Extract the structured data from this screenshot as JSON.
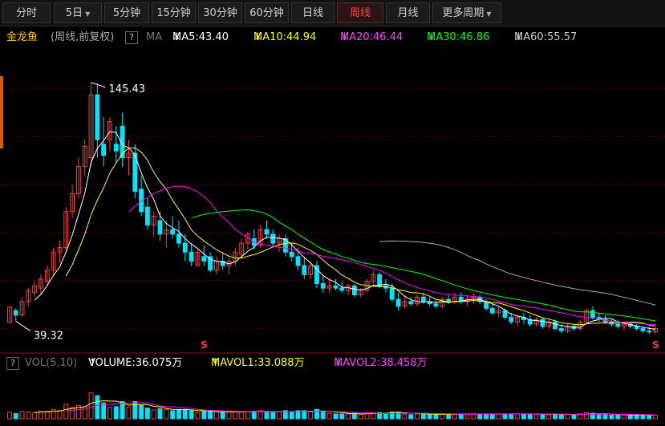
{
  "toolbar": {
    "tabs": [
      {
        "label": "分时",
        "active": false,
        "dropdown": false
      },
      {
        "label": "5日",
        "active": false,
        "dropdown": true
      },
      {
        "label": "5分钟",
        "active": false,
        "dropdown": false
      },
      {
        "label": "15分钟",
        "active": false,
        "dropdown": false
      },
      {
        "label": "30分钟",
        "active": false,
        "dropdown": false
      },
      {
        "label": "60分钟",
        "active": false,
        "dropdown": false
      },
      {
        "label": "日线",
        "active": false,
        "dropdown": false
      },
      {
        "label": "周线",
        "active": true,
        "dropdown": false
      },
      {
        "label": "月线",
        "active": false,
        "dropdown": false
      },
      {
        "label": "更多周期",
        "active": false,
        "dropdown": true
      }
    ]
  },
  "header": {
    "stock_name": "金龙鱼",
    "mode": "(周线,前复权)",
    "help": "?",
    "ma_label": "MA",
    "ma5": "MA5:43.40",
    "ma10": "MA10:44.94",
    "ma20": "MA20:46.44",
    "ma30": "MA30:46.86",
    "ma60": "MA60:55.57",
    "arrow_down": "↓"
  },
  "volume_header": {
    "label": "VOL(5,10)",
    "volume": "VOLUME:36.075万",
    "mavol1": "MAVOL1:33.088万",
    "mavol2": "MAVOL2:38.458万",
    "arrow_up": "↑",
    "arrow_down": "↓",
    "help": "?"
  },
  "colors": {
    "up": "#ff3c3c",
    "down": "#00e5ff",
    "ma5": "#ffffff",
    "ma10": "#ffff00",
    "ma20": "#ff00ff",
    "ma30": "#00ff00",
    "ma60": "#aaaaaa",
    "active_tab": "#ff4a4a"
  },
  "chart_data": {
    "type": "candlestick",
    "period": "weekly",
    "annotations": {
      "max_label": "145.43",
      "min_label": "39.32",
      "s_marker": "S"
    },
    "ylim": [
      33,
      150
    ],
    "weeks_ohlc": [
      [
        38.8,
        46,
        38.5,
        45.5
      ],
      [
        44,
        45,
        39.4,
        42
      ],
      [
        42,
        50,
        41,
        48
      ],
      [
        48,
        54,
        46,
        53
      ],
      [
        52,
        57,
        50,
        55
      ],
      [
        54,
        60,
        51,
        58
      ],
      [
        57,
        64,
        55,
        62
      ],
      [
        62,
        72,
        60,
        70
      ],
      [
        70,
        75,
        65,
        72
      ],
      [
        72,
        90,
        70,
        88
      ],
      [
        88,
        100,
        85,
        96
      ],
      [
        96,
        112,
        94,
        108
      ],
      [
        108,
        120,
        104,
        117
      ],
      [
        112,
        145.43,
        108,
        140
      ],
      [
        140,
        145,
        112,
        120
      ],
      [
        118,
        130,
        108,
        113
      ],
      [
        120,
        130,
        115,
        128
      ],
      [
        118,
        126,
        110,
        115
      ],
      [
        126,
        132,
        108,
        112
      ],
      [
        112,
        120,
        104,
        114
      ],
      [
        114,
        118,
        94,
        97
      ],
      [
        98,
        104,
        86,
        88
      ],
      [
        90,
        94,
        80,
        82
      ],
      [
        82,
        88,
        77,
        86
      ],
      [
        84,
        88,
        75,
        78
      ],
      [
        78,
        84,
        72,
        80
      ],
      [
        80,
        86,
        76,
        78
      ],
      [
        78,
        84,
        72,
        74
      ],
      [
        74,
        78,
        66,
        70
      ],
      [
        70,
        74,
        64,
        66
      ],
      [
        64,
        71,
        64,
        70
      ],
      [
        68,
        73,
        64,
        66
      ],
      [
        68,
        70,
        61,
        62
      ],
      [
        62,
        68,
        60,
        66
      ],
      [
        66,
        70,
        62,
        64
      ],
      [
        64,
        68,
        60,
        66
      ],
      [
        66,
        72,
        64,
        70
      ],
      [
        69,
        76,
        67,
        74
      ],
      [
        74,
        79,
        71,
        78
      ],
      [
        76,
        80,
        71,
        73
      ],
      [
        73,
        82,
        72,
        80
      ],
      [
        80,
        84,
        76,
        78
      ],
      [
        78,
        80,
        72,
        74
      ],
      [
        74,
        78,
        70,
        76
      ],
      [
        76,
        78,
        68,
        70
      ],
      [
        70,
        74,
        66,
        68
      ],
      [
        68,
        72,
        62,
        64
      ],
      [
        64,
        68,
        58,
        60
      ],
      [
        60,
        66,
        58,
        64
      ],
      [
        64,
        66,
        54,
        56
      ],
      [
        56,
        60,
        52,
        54
      ],
      [
        54,
        58,
        52,
        55
      ],
      [
        55,
        58,
        53,
        54
      ],
      [
        54,
        57,
        52,
        53
      ],
      [
        53,
        56,
        51,
        55
      ],
      [
        55,
        56,
        50,
        51
      ],
      [
        51,
        54,
        50,
        53
      ],
      [
        53,
        58,
        52,
        57
      ],
      [
        57,
        62,
        55,
        60
      ],
      [
        60,
        61,
        54,
        55
      ],
      [
        55,
        58,
        52,
        54
      ],
      [
        54,
        56,
        48,
        49
      ],
      [
        49,
        52,
        44,
        46
      ],
      [
        46,
        50,
        45,
        48
      ],
      [
        48,
        50,
        46,
        47
      ],
      [
        47,
        51,
        46,
        50
      ],
      [
        50,
        52,
        47,
        48
      ],
      [
        48,
        50,
        46,
        47
      ],
      [
        47,
        49,
        45,
        46
      ],
      [
        46,
        50,
        45,
        49
      ],
      [
        49,
        51,
        47,
        48
      ],
      [
        48,
        52,
        47,
        50
      ],
      [
        50,
        52,
        47,
        48
      ],
      [
        48,
        51,
        46,
        49
      ],
      [
        49,
        52,
        47,
        50
      ],
      [
        50,
        51,
        47,
        48
      ],
      [
        48,
        49,
        44,
        45
      ],
      [
        45,
        47,
        42,
        43
      ],
      [
        43,
        46,
        41,
        44
      ],
      [
        44,
        45,
        40,
        41
      ],
      [
        41,
        43,
        38,
        39
      ],
      [
        39,
        42,
        37,
        41
      ],
      [
        41,
        43,
        38,
        40
      ],
      [
        40,
        42,
        37,
        38
      ],
      [
        38,
        41,
        37,
        40
      ],
      [
        40,
        41,
        36,
        37
      ],
      [
        37,
        40,
        36,
        39
      ],
      [
        39,
        40,
        35,
        36
      ],
      [
        36,
        38,
        34,
        35
      ],
      [
        35,
        38,
        34,
        37
      ],
      [
        37,
        38,
        35,
        36
      ],
      [
        36,
        40,
        35,
        39
      ],
      [
        39,
        45,
        38,
        44
      ],
      [
        44,
        46,
        40,
        41
      ],
      [
        41,
        43,
        39,
        40
      ],
      [
        40,
        42,
        38,
        39
      ],
      [
        39,
        40,
        37,
        38
      ],
      [
        38,
        40,
        36,
        37
      ],
      [
        37,
        39,
        35,
        38
      ],
      [
        38,
        39,
        36,
        37
      ],
      [
        37,
        38,
        35,
        36
      ],
      [
        36,
        37,
        34,
        35
      ],
      [
        35,
        37,
        33.5,
        34.5
      ],
      [
        34.5,
        36.5,
        33.5,
        36
      ]
    ],
    "s_marker_weeks": [
      31,
      103
    ],
    "volume_ylim": [
      0,
      160
    ],
    "volume_label_unit": "万"
  }
}
